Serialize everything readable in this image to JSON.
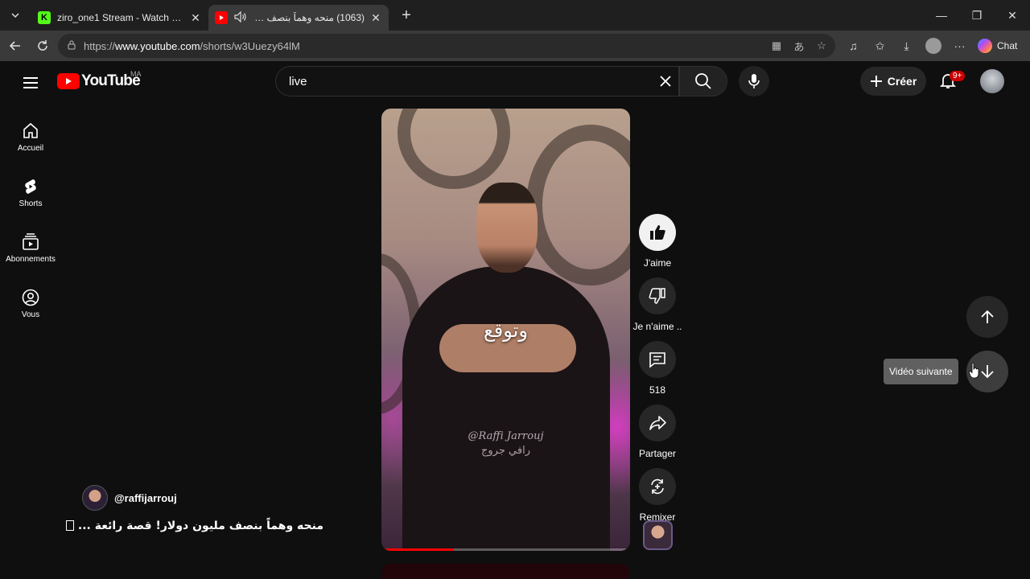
{
  "browser": {
    "tabs": [
      {
        "title": "ziro_one1 Stream - Watch Live on",
        "favicon": "kick-icon",
        "active": false
      },
      {
        "title": "(1063) منحه وهماً بنصف مليون",
        "favicon": "youtube-icon",
        "active": true,
        "audio": true
      }
    ],
    "url_prefix": "https://",
    "url_host": "www.youtube.com",
    "url_path": "/shorts/w3Uuezy64lM",
    "chat_label": "Chat"
  },
  "youtube": {
    "logo_text": "YouTube",
    "country_code": "MA",
    "search_value": "live",
    "create_label": "Créer",
    "notification_count": "9+",
    "sidenav": [
      {
        "label": "Accueil",
        "icon": "home-icon"
      },
      {
        "label": "Shorts",
        "icon": "shorts-icon"
      },
      {
        "label": "Abonnements",
        "icon": "subscriptions-icon"
      },
      {
        "label": "Vous",
        "icon": "you-icon"
      }
    ],
    "short": {
      "caption_overlay": "وتوقع",
      "watermark_latin": "@Raffi Jarrouj",
      "watermark_arabic": "رافي جروج",
      "progress": 0.29,
      "channel_handle": "@raffijarrouj",
      "title": "منحه وهماً بنصف مليون دولار! قصة رائعة  ..."
    },
    "actions": {
      "like_label": "J'aime",
      "dislike_label": "Je n'aime ..",
      "comments_count": "518",
      "share_label": "Partager",
      "remix_label": "Remixer"
    },
    "tooltip_next": "Vidéo suivante"
  },
  "colors": {
    "accent": "#ff0000",
    "background": "#0f0f0f"
  }
}
